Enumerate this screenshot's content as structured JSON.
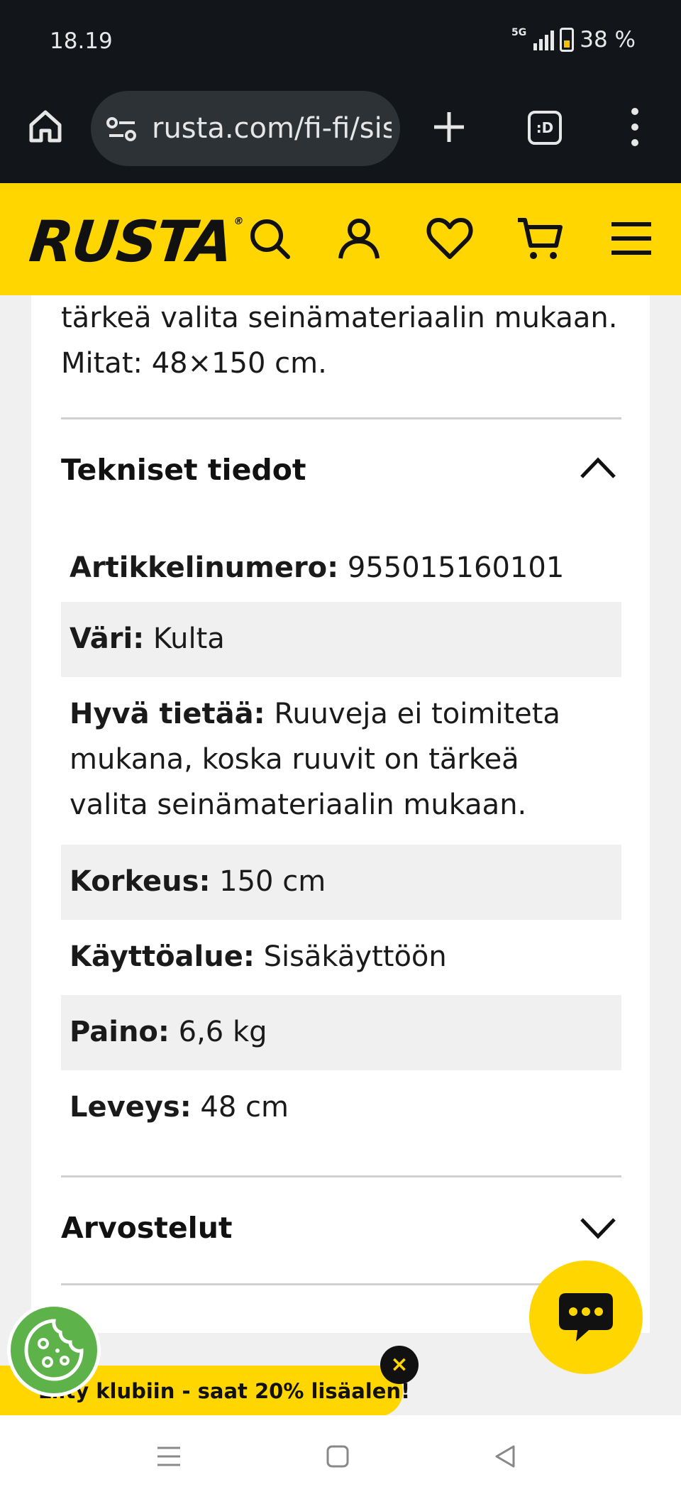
{
  "status_bar": {
    "time": "18.19",
    "network": "5G",
    "battery": "38 %"
  },
  "browser": {
    "url": "rusta.com/fi-fi/sis",
    "tabs_label": ":D"
  },
  "site": {
    "logo": "RUSTA",
    "logo_mark": "®",
    "brand_color": "#ffd600"
  },
  "product": {
    "intro_text": "tärkeä valita seinämateriaalin mukaan. Mitat: 48×150 cm.",
    "specs_section": {
      "title": "Tekniset tiedot",
      "expanded": true,
      "rows": [
        {
          "label": "Artikkelinumero:",
          "value": "955015160101"
        },
        {
          "label": "Väri:",
          "value": "Kulta"
        },
        {
          "label": "Hyvä tietää:",
          "value": "Ruuveja ei toimiteta mukana, koska ruuvit on tärkeä valita seinämateriaalin mukaan."
        },
        {
          "label": "Korkeus:",
          "value": "150 cm"
        },
        {
          "label": "Käyttöalue:",
          "value": "Sisäkäyttöön"
        },
        {
          "label": "Paino:",
          "value": "6,6 kg"
        },
        {
          "label": "Leveys:",
          "value": "48 cm"
        }
      ]
    },
    "reviews_section": {
      "title": "Arvostelut",
      "expanded": false
    }
  },
  "promo": {
    "text": "Liity klubiin - saat 20% lisäalen!",
    "close_label": "×"
  }
}
